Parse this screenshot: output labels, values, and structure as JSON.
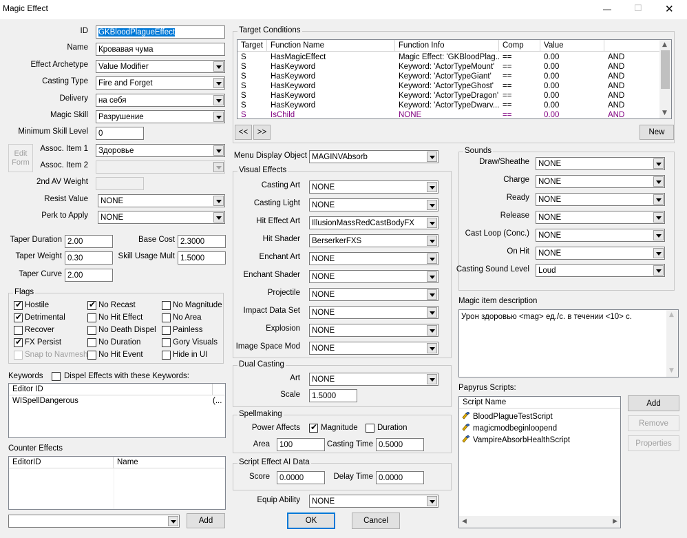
{
  "window": {
    "title": "Magic Effect",
    "minimize": "—",
    "maximize": "☐",
    "close": "✕"
  },
  "left": {
    "id_label": "ID",
    "id_value": "GKBloodPlagueEffect",
    "name_label": "Name",
    "name_value": "Кровавая чума",
    "archetype_label": "Effect Archetype",
    "archetype_value": "Value Modifier",
    "casting_type_label": "Casting Type",
    "casting_type_value": "Fire and Forget",
    "delivery_label": "Delivery",
    "delivery_value": "на себя",
    "magic_skill_label": "Magic Skill",
    "magic_skill_value": "Разрушение",
    "min_skill_label": "Minimum Skill Level",
    "min_skill_value": "0",
    "edit_form_label": "Edit Form",
    "assoc1_label": "Assoc. Item 1",
    "assoc1_value": "Здоровье",
    "assoc2_label": "Assoc. Item 2",
    "assoc2_value": "",
    "av_weight_label": "2nd AV Weight",
    "av_weight_value": "",
    "resist_label": "Resist Value",
    "resist_value": "NONE",
    "perk_label": "Perk to Apply",
    "perk_value": "NONE",
    "taper_duration_label": "Taper Duration",
    "taper_duration_value": "2.00",
    "base_cost_label": "Base Cost",
    "base_cost_value": "2.3000",
    "taper_weight_label": "Taper Weight",
    "taper_weight_value": "0.30",
    "skill_mult_label": "Skill Usage Mult",
    "skill_mult_value": "1.5000",
    "taper_curve_label": "Taper Curve",
    "taper_curve_value": "2.00"
  },
  "flags": {
    "title": "Flags",
    "items": [
      {
        "label": "Hostile",
        "checked": true,
        "disabled": false
      },
      {
        "label": "No Recast",
        "checked": true,
        "disabled": false
      },
      {
        "label": "No Magnitude",
        "checked": false,
        "disabled": false
      },
      {
        "label": "Detrimental",
        "checked": true,
        "disabled": false
      },
      {
        "label": "No Hit Effect",
        "checked": false,
        "disabled": false
      },
      {
        "label": "No Area",
        "checked": false,
        "disabled": false
      },
      {
        "label": "Recover",
        "checked": false,
        "disabled": false
      },
      {
        "label": "No Death Dispel",
        "checked": false,
        "disabled": false
      },
      {
        "label": "Painless",
        "checked": false,
        "disabled": false
      },
      {
        "label": "FX Persist",
        "checked": true,
        "disabled": false
      },
      {
        "label": "No Duration",
        "checked": false,
        "disabled": false
      },
      {
        "label": "Gory Visuals",
        "checked": false,
        "disabled": false
      },
      {
        "label": "Snap to Navmesh",
        "checked": false,
        "disabled": true
      },
      {
        "label": "No Hit Event",
        "checked": false,
        "disabled": false
      },
      {
        "label": "Hide in UI",
        "checked": false,
        "disabled": false
      }
    ]
  },
  "keywords": {
    "label": "Keywords",
    "dispel_label": "Dispel Effects with these Keywords:",
    "col_editor_id": "Editor ID",
    "rows": [
      {
        "id": "WISpellDangerous",
        "extra": "(..."
      }
    ]
  },
  "counter": {
    "label": "Counter Effects",
    "col1": "EditorID",
    "col2": "Name",
    "add_label": "Add",
    "select_value": ""
  },
  "target": {
    "title": "Target Conditions",
    "columns": [
      "Target",
      "Function Name",
      "Function Info",
      "Comp",
      "Value",
      ""
    ],
    "rows": [
      {
        "target": "S",
        "fn": "HasMagicEffect",
        "info": "Magic Effect: 'GKBloodPlag...",
        "comp": "==",
        "value": "0.00",
        "op": "AND",
        "purple": false
      },
      {
        "target": "S",
        "fn": "HasKeyword",
        "info": "Keyword: 'ActorTypeMount'",
        "comp": "==",
        "value": "0.00",
        "op": "AND",
        "purple": false
      },
      {
        "target": "S",
        "fn": "HasKeyword",
        "info": "Keyword: 'ActorTypeGiant'",
        "comp": "==",
        "value": "0.00",
        "op": "AND",
        "purple": false
      },
      {
        "target": "S",
        "fn": "HasKeyword",
        "info": "Keyword: 'ActorTypeGhost'",
        "comp": "==",
        "value": "0.00",
        "op": "AND",
        "purple": false
      },
      {
        "target": "S",
        "fn": "HasKeyword",
        "info": "Keyword: 'ActorTypeDragon'",
        "comp": "==",
        "value": "0.00",
        "op": "AND",
        "purple": false
      },
      {
        "target": "S",
        "fn": "HasKeyword",
        "info": "Keyword: 'ActorTypeDwarv...",
        "comp": "==",
        "value": "0.00",
        "op": "AND",
        "purple": false
      },
      {
        "target": "S",
        "fn": "IsChild",
        "info": "NONE",
        "comp": "==",
        "value": "0.00",
        "op": "AND",
        "purple": true
      }
    ],
    "prev_label": "<<",
    "next_label": ">>",
    "new_label": "New"
  },
  "menu_display": {
    "label": "Menu Display Object",
    "value": "MAGINVAbsorb"
  },
  "visual": {
    "title": "Visual Effects",
    "items": [
      {
        "label": "Casting Art",
        "value": "NONE"
      },
      {
        "label": "Casting Light",
        "value": "NONE"
      },
      {
        "label": "Hit Effect Art",
        "value": "IllusionMassRedCastBodyFX"
      },
      {
        "label": "Hit Shader",
        "value": "BerserkerFXS"
      },
      {
        "label": "Enchant Art",
        "value": "NONE"
      },
      {
        "label": "Enchant Shader",
        "value": "NONE"
      },
      {
        "label": "Projectile",
        "value": "NONE"
      },
      {
        "label": "Impact Data Set",
        "value": "NONE"
      },
      {
        "label": "Explosion",
        "value": "NONE"
      },
      {
        "label": "Image Space Mod",
        "value": "NONE"
      }
    ]
  },
  "dual": {
    "title": "Dual Casting",
    "art_label": "Art",
    "art_value": "NONE",
    "scale_label": "Scale",
    "scale_value": "1.5000"
  },
  "spellmaking": {
    "title": "Spellmaking",
    "power_label": "Power Affects",
    "magnitude_label": "Magnitude",
    "magnitude_checked": true,
    "duration_label": "Duration",
    "duration_checked": false,
    "area_label": "Area",
    "area_value": "100",
    "casting_time_label": "Casting Time",
    "casting_time_value": "0.5000"
  },
  "ai": {
    "title": "Script Effect AI Data",
    "score_label": "Score",
    "score_value": "0.0000",
    "delay_label": "Delay Time",
    "delay_value": "0.0000"
  },
  "equip": {
    "label": "Equip Ability",
    "value": "NONE"
  },
  "buttons": {
    "ok": "OK",
    "cancel": "Cancel"
  },
  "sounds": {
    "title": "Sounds",
    "items": [
      {
        "label": "Draw/Sheathe",
        "value": "NONE"
      },
      {
        "label": "Charge",
        "value": "NONE"
      },
      {
        "label": "Ready",
        "value": "NONE"
      },
      {
        "label": "Release",
        "value": "NONE"
      },
      {
        "label": "Cast Loop (Conc.)",
        "value": "NONE"
      },
      {
        "label": "On Hit",
        "value": "NONE"
      }
    ],
    "level_label": "Casting Sound Level",
    "level_value": "Loud"
  },
  "description": {
    "label": "Magic item description",
    "value": "Урон здоровью <mag> ед./с. в течении <10> с."
  },
  "scripts": {
    "label": "Papyrus Scripts:",
    "col": "Script Name",
    "items": [
      "BloodPlagueTestScript",
      "magicmodbeginloopend",
      "VampireAbsorbHealthScript"
    ],
    "add_label": "Add",
    "remove_label": "Remove",
    "properties_label": "Properties"
  }
}
